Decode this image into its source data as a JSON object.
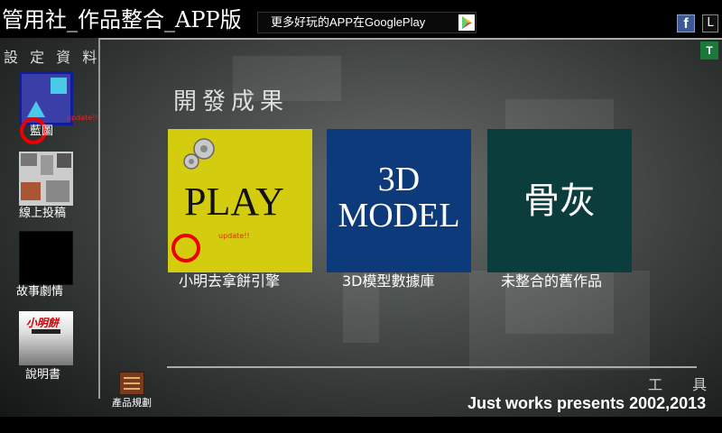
{
  "header": {
    "app_title": "管用社_作品整合_APP版",
    "promo_text": "更多好玩的APP在GooglePlay",
    "l_button": "L",
    "t_button": "T",
    "facebook_glyph": "f"
  },
  "sidebar": {
    "heading": "設 定 資 料",
    "items": [
      {
        "label": "藍圖",
        "update_badge": "update!!"
      },
      {
        "label": "線上投稿"
      },
      {
        "label": "故事劇情"
      },
      {
        "label": "說明書",
        "thumb_logo": "小明餅"
      }
    ]
  },
  "main": {
    "section_title": "開發成果",
    "tiles": [
      {
        "image_text": "PLAY",
        "caption": "小明去拿餅引擎",
        "update_badge": "update!!",
        "color": "#d4cc0e"
      },
      {
        "image_text_line1": "3D",
        "image_text_line2": "MODEL",
        "caption": "3D模型數據庫",
        "color": "#0c3a7a"
      },
      {
        "image_text": "骨灰",
        "caption": "未整合的舊作品",
        "color": "#0a3d3b"
      }
    ]
  },
  "footer": {
    "tools_label": "工 具",
    "planning_label": "產品規劃",
    "copyright": "Just works presents 2002,2013"
  },
  "icons": [
    "google-play-icon",
    "facebook-icon",
    "gear-icon",
    "planning-icon"
  ]
}
